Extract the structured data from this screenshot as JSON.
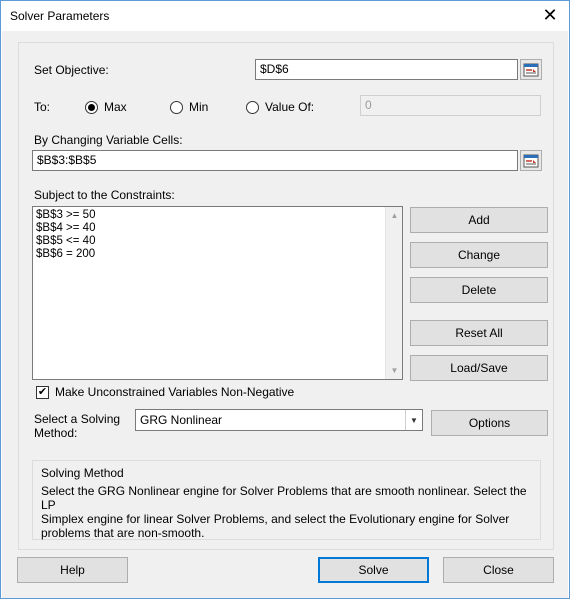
{
  "window": {
    "title": "Solver Parameters",
    "close_glyph": "✕"
  },
  "objective": {
    "label": "Set Objective:",
    "value": "$D$6"
  },
  "to": {
    "label": "To:",
    "options": [
      "Max",
      "Min",
      "Value Of:"
    ],
    "selected": "Max",
    "value_of": "0"
  },
  "changing": {
    "label": "By Changing Variable Cells:",
    "value": "$B$3:$B$5"
  },
  "constraints": {
    "label": "Subject to the Constraints:",
    "items": [
      "$B$3 >= 50",
      "$B$4 >= 40",
      "$B$5 <= 40",
      "$B$6 = 200"
    ]
  },
  "buttons": {
    "add": "Add",
    "change": "Change",
    "delete": "Delete",
    "reset_all": "Reset All",
    "load_save": "Load/Save",
    "options": "Options",
    "help": "Help",
    "solve": "Solve",
    "close": "Close"
  },
  "nonneg": {
    "label": "Make Unconstrained Variables Non-Negative",
    "checked": true
  },
  "method": {
    "label_line1": "Select a Solving",
    "label_line2": "Method:",
    "selected": "GRG Nonlinear"
  },
  "solving_method": {
    "title": "Solving Method",
    "line1": "Select the GRG Nonlinear engine for Solver Problems that are smooth nonlinear. Select the LP",
    "line2": "Simplex engine for linear Solver Problems, and select the Evolutionary engine for Solver",
    "line3": "problems that are non-smooth."
  },
  "icons": {
    "ref": "collapse-dialog-icon",
    "check": "checkmark-icon",
    "dropdown": "chevron-down-icon",
    "close": "close-icon"
  }
}
